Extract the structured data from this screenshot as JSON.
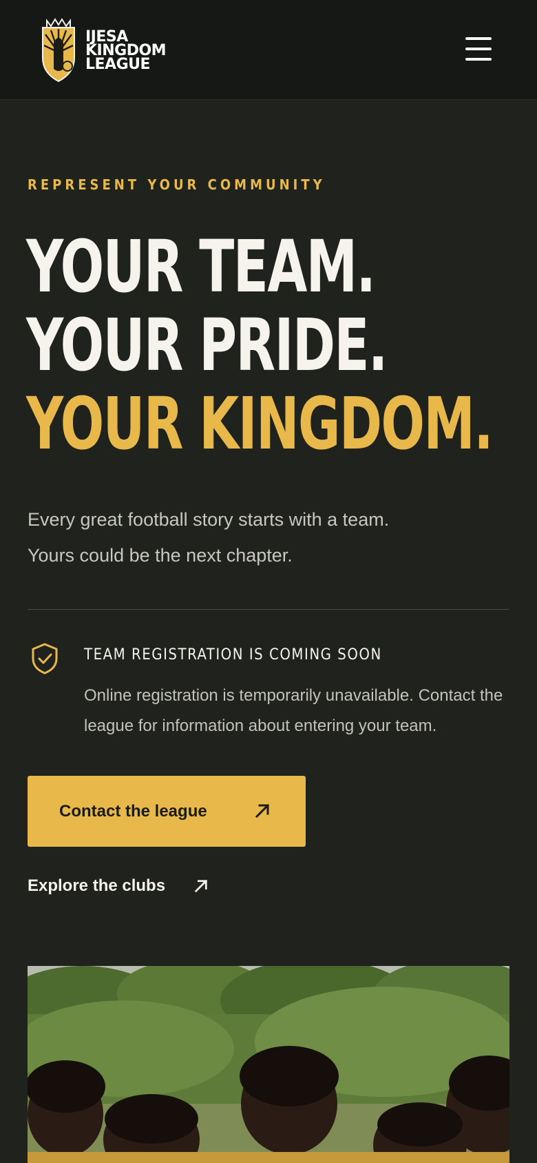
{
  "brand": {
    "line1": "IJESA",
    "line2": "KINGDOM",
    "line3": "LEAGUE"
  },
  "hero": {
    "eyebrow": "REPRESENT YOUR COMMUNITY",
    "headline_line1": "YOUR TEAM.",
    "headline_line2": "YOUR PRIDE.",
    "headline_line3": "YOUR KINGDOM.",
    "lead_line1": "Every great football story starts with a team.",
    "lead_line2": "Yours could be the next chapter."
  },
  "notice": {
    "title": "TEAM REGISTRATION IS COMING SOON",
    "body": "Online registration is temporarily unavailable. Contact the league for information about entering your team."
  },
  "actions": {
    "primary_label": "Contact the league",
    "secondary_label": "Explore the clubs"
  },
  "colors": {
    "accent": "#e8b94a",
    "background": "#20221e",
    "navbar": "#161816"
  },
  "icons": {
    "menu": "hamburger-menu-icon",
    "notice": "shield-check-icon",
    "arrow": "arrow-up-right-icon"
  }
}
